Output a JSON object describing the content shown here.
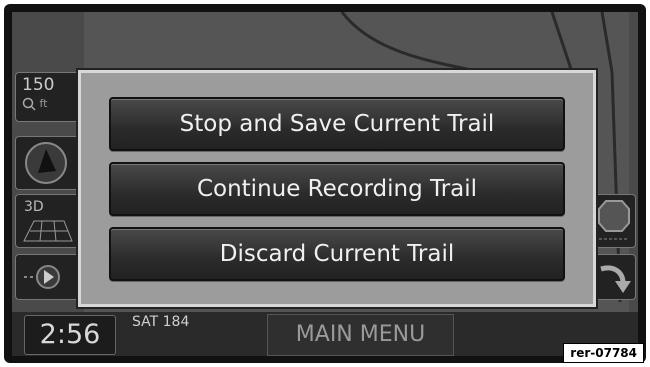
{
  "map": {
    "scale_value": "150",
    "scale_unit": "ft",
    "view_mode": "3D",
    "icons": [
      "zoom-icon",
      "compass-icon",
      "view-3d-icon",
      "route-icon",
      "stop-icon",
      "turn-arrow-icon"
    ]
  },
  "dialog": {
    "options": [
      {
        "label": "Stop and Save Current Trail"
      },
      {
        "label": "Continue Recording Trail"
      },
      {
        "label": "Discard Current Trail"
      }
    ]
  },
  "status_bar": {
    "time": "2:56",
    "day_date": "SAT 184",
    "main_menu_label": "MAIN MENU"
  },
  "reference_code": "rer-07784"
}
